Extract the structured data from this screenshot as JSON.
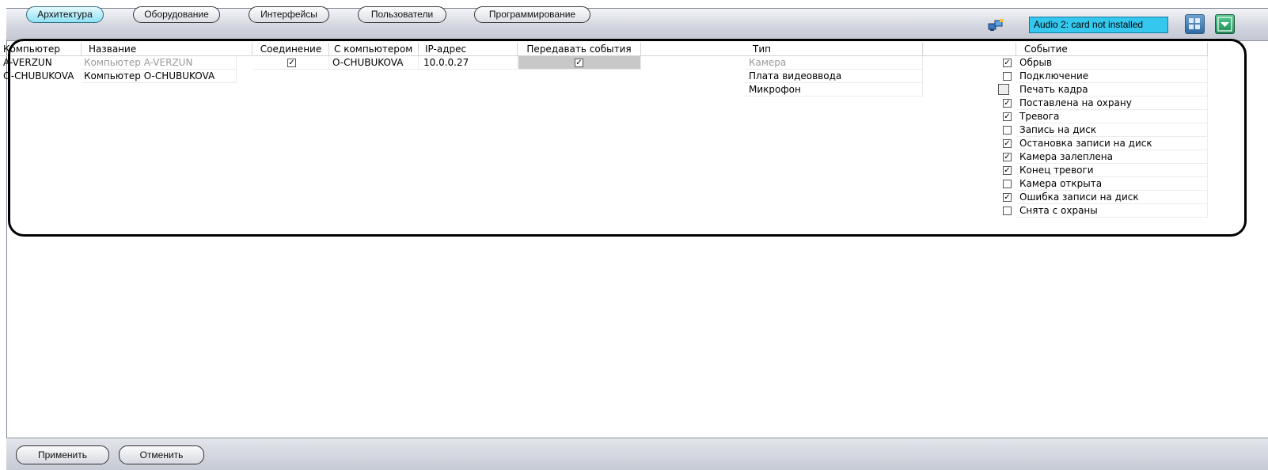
{
  "tabs": [
    {
      "label": "Архитектура",
      "active": true
    },
    {
      "label": "Оборудование",
      "active": false
    },
    {
      "label": "Интерфейсы",
      "active": false
    },
    {
      "label": "Пользователи",
      "active": false
    },
    {
      "label": "Программирование",
      "active": false
    }
  ],
  "status": {
    "audio_text": "Audio 2: card not installed"
  },
  "toolbar_icons": [
    "network-status-icon",
    "layout-grid-icon",
    "dropdown-arrow-icon"
  ],
  "computers_table": {
    "headers": [
      "Компьютер",
      "Название",
      "Соединение"
    ],
    "rows": [
      {
        "computer": "A-VERZUN",
        "name": "Компьютер A-VERZUN",
        "disabled": true,
        "connection": true
      },
      {
        "computer": "O-CHUBUKOVA",
        "name": "Компьютер O-CHUBUKOVA",
        "disabled": false,
        "connection": null
      }
    ]
  },
  "connections_table": {
    "headers": [
      "С компьютером",
      "IP-адрес",
      "Передавать события"
    ],
    "rows": [
      {
        "peer": "O-CHUBUKOVA",
        "ip": "10.0.0.27",
        "send_events": true
      }
    ]
  },
  "types_table": {
    "header": "Тип",
    "rows": [
      {
        "label": "Камера",
        "disabled": true
      },
      {
        "label": "Плата видеоввода",
        "disabled": false
      },
      {
        "label": "Микрофон",
        "disabled": false
      }
    ]
  },
  "events_table": {
    "header": "Событие",
    "rows": [
      {
        "label": "Обрыв",
        "checked": true
      },
      {
        "label": "Подключение",
        "checked": false
      },
      {
        "label": "Печать кадра",
        "checked": false
      },
      {
        "label": "Поставлена на охрану",
        "checked": true
      },
      {
        "label": "Тревога",
        "checked": true
      },
      {
        "label": "Запись на диск",
        "checked": false
      },
      {
        "label": "Остановка записи на диск",
        "checked": true
      },
      {
        "label": "Камера залеплена",
        "checked": true
      },
      {
        "label": "Конец тревоги",
        "checked": true
      },
      {
        "label": "Камера открыта",
        "checked": false
      },
      {
        "label": "Ошибка записи на диск",
        "checked": true
      },
      {
        "label": "Снята с охраны",
        "checked": false
      }
    ]
  },
  "footer": {
    "apply_label": "Применить",
    "cancel_label": "Отменить"
  },
  "colors": {
    "accent": "#35c8ee",
    "active_tab": "#8fe1f5",
    "outline": "#000000"
  }
}
